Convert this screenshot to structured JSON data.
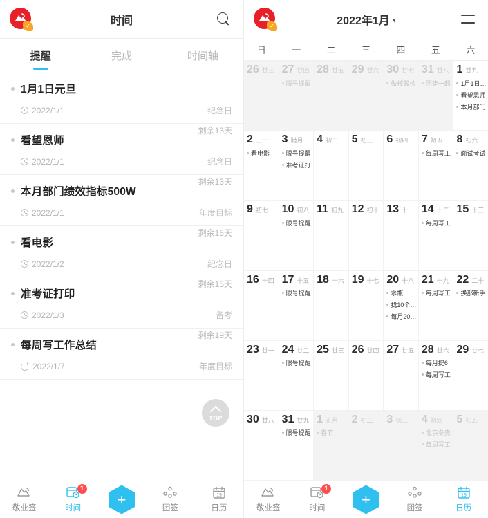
{
  "left_panel": {
    "appbar": {
      "title": "时间",
      "search_icon": "search-icon",
      "logo_icon": "app-logo"
    },
    "tabs": [
      {
        "label": "提醒",
        "active": true
      },
      {
        "label": "完成",
        "active": false
      },
      {
        "label": "时间轴",
        "active": false
      }
    ],
    "tasks": [
      {
        "title": "1月1日元旦",
        "date": "2022/1/1",
        "tag": "纪念日",
        "remain": "剩余13天",
        "date_icon": "clock-icon"
      },
      {
        "title": "看望恩师",
        "date": "2022/1/1",
        "tag": "纪念日",
        "remain": "剩余13天",
        "date_icon": "clock-icon"
      },
      {
        "title": "本月部门绩效指标500W",
        "date": "2022/1/1",
        "tag": "年度目标",
        "remain": "剩余15天",
        "date_icon": "clock-icon"
      },
      {
        "title": "看电影",
        "date": "2022/1/2",
        "tag": "纪念日",
        "remain": "剩余15天",
        "date_icon": "clock-icon"
      },
      {
        "title": "准考证打印",
        "date": "2022/1/3",
        "tag": "备考",
        "remain": "剩余19天",
        "date_icon": "clock-icon"
      },
      {
        "title": "每周写工作总结",
        "date": "2022/1/7",
        "tag": "年度目标",
        "remain": "",
        "date_icon": "repeat-icon"
      }
    ],
    "scroll_top_button": {
      "label": "TOP",
      "icon": "chevron-up-icon"
    }
  },
  "right_panel": {
    "appbar": {
      "title": "2022年1月",
      "caret_icon": "chevron-down-icon",
      "menu_icon": "hamburger-icon",
      "logo_icon": "app-logo"
    },
    "weekdays": [
      "日",
      "一",
      "二",
      "三",
      "四",
      "五",
      "六"
    ],
    "weeks": [
      [
        {
          "day": "26",
          "lunar": "廿三",
          "out": true,
          "events": []
        },
        {
          "day": "27",
          "lunar": "廿四",
          "out": true,
          "events": [
            "限号提醒"
          ]
        },
        {
          "day": "28",
          "lunar": "廿五",
          "out": true,
          "events": []
        },
        {
          "day": "29",
          "lunar": "廿六",
          "out": true,
          "events": []
        },
        {
          "day": "30",
          "lunar": "廿七",
          "out": true,
          "events": [
            "做核酸检…"
          ]
        },
        {
          "day": "31",
          "lunar": "廿八",
          "out": true,
          "events": [
            "团建一起…"
          ]
        },
        {
          "day": "1",
          "lunar": "廿九",
          "out": false,
          "events": [
            "1月1日…",
            "看望恩师",
            "本月部门…"
          ]
        }
      ],
      [
        {
          "day": "2",
          "lunar": "三十",
          "out": false,
          "events": [
            "看电影"
          ]
        },
        {
          "day": "3",
          "lunar": "腊月",
          "out": false,
          "events": [
            "限号提醒",
            "准考证打…"
          ]
        },
        {
          "day": "4",
          "lunar": "初二",
          "out": false,
          "events": []
        },
        {
          "day": "5",
          "lunar": "初三",
          "out": false,
          "events": []
        },
        {
          "day": "6",
          "lunar": "初四",
          "out": false,
          "events": []
        },
        {
          "day": "7",
          "lunar": "初五",
          "out": false,
          "events": [
            "每周写工…"
          ]
        },
        {
          "day": "8",
          "lunar": "初六",
          "out": false,
          "events": [
            "面试考试"
          ]
        }
      ],
      [
        {
          "day": "9",
          "lunar": "初七",
          "out": false,
          "events": []
        },
        {
          "day": "10",
          "lunar": "初八",
          "out": false,
          "events": [
            "限号提醒"
          ]
        },
        {
          "day": "11",
          "lunar": "初九",
          "out": false,
          "events": []
        },
        {
          "day": "12",
          "lunar": "初十",
          "out": false,
          "events": []
        },
        {
          "day": "13",
          "lunar": "十一",
          "out": false,
          "events": []
        },
        {
          "day": "14",
          "lunar": "十二",
          "out": false,
          "events": [
            "每周写工…"
          ]
        },
        {
          "day": "15",
          "lunar": "十三",
          "out": false,
          "events": []
        }
      ],
      [
        {
          "day": "16",
          "lunar": "十四",
          "out": false,
          "events": []
        },
        {
          "day": "17",
          "lunar": "十五",
          "out": false,
          "events": [
            "限号提醒"
          ]
        },
        {
          "day": "18",
          "lunar": "十六",
          "out": false,
          "events": []
        },
        {
          "day": "19",
          "lunar": "十七",
          "out": false,
          "events": []
        },
        {
          "day": "20",
          "lunar": "十八",
          "out": false,
          "events": [
            "水瓶",
            "找10个…",
            "每月20…"
          ]
        },
        {
          "day": "21",
          "lunar": "十九",
          "out": false,
          "events": [
            "每周写工…"
          ]
        },
        {
          "day": "22",
          "lunar": "二十",
          "out": false,
          "events": [
            "换部新手…"
          ]
        }
      ],
      [
        {
          "day": "23",
          "lunar": "廿一",
          "out": false,
          "events": []
        },
        {
          "day": "24",
          "lunar": "廿二",
          "out": false,
          "events": [
            "限号提醒"
          ]
        },
        {
          "day": "25",
          "lunar": "廿三",
          "out": false,
          "events": []
        },
        {
          "day": "26",
          "lunar": "廿四",
          "out": false,
          "events": []
        },
        {
          "day": "27",
          "lunar": "廿五",
          "out": false,
          "events": []
        },
        {
          "day": "28",
          "lunar": "廿六",
          "out": false,
          "events": [
            "每月提6…",
            "每周写工…"
          ]
        },
        {
          "day": "29",
          "lunar": "廿七",
          "out": false,
          "events": []
        }
      ],
      [
        {
          "day": "30",
          "lunar": "廿八",
          "out": false,
          "events": []
        },
        {
          "day": "31",
          "lunar": "廿九",
          "out": false,
          "events": [
            "限号提醒"
          ]
        },
        {
          "day": "1",
          "lunar": "正月",
          "out": true,
          "events": [
            "春节"
          ]
        },
        {
          "day": "2",
          "lunar": "初二",
          "out": true,
          "events": []
        },
        {
          "day": "3",
          "lunar": "初三",
          "out": true,
          "events": []
        },
        {
          "day": "4",
          "lunar": "初四",
          "out": true,
          "events": [
            "北京冬奥…",
            "每周写工…"
          ]
        },
        {
          "day": "5",
          "lunar": "初五",
          "out": true,
          "events": []
        }
      ]
    ]
  },
  "bottom_nav_left": {
    "items": [
      {
        "label": "敬业签",
        "icon": "note-icon",
        "active": false,
        "badge": ""
      },
      {
        "label": "时间",
        "icon": "time-icon",
        "active": true,
        "badge": "1"
      },
      {
        "label": "",
        "icon": "add-icon",
        "active": false,
        "badge": ""
      },
      {
        "label": "团签",
        "icon": "team-icon",
        "active": false,
        "badge": ""
      },
      {
        "label": "日历",
        "icon": "calendar-icon",
        "active": false,
        "badge": ""
      }
    ],
    "add_label": "+"
  },
  "bottom_nav_right": {
    "items": [
      {
        "label": "敬业签",
        "icon": "note-icon",
        "active": false,
        "badge": ""
      },
      {
        "label": "时间",
        "icon": "time-icon",
        "active": false,
        "badge": "1"
      },
      {
        "label": "",
        "icon": "add-icon",
        "active": false,
        "badge": ""
      },
      {
        "label": "团签",
        "icon": "team-icon",
        "active": false,
        "badge": ""
      },
      {
        "label": "日历",
        "icon": "calendar-icon",
        "active": true,
        "badge": ""
      }
    ],
    "add_label": "+"
  },
  "colors": {
    "accent": "#2fc0ef",
    "logo_red": "#e8202a",
    "badge_red": "#ff4d4f",
    "logo_badge_orange": "#f6a623",
    "muted_text": "#b9b9b9"
  },
  "calendar_day_icon": "19"
}
